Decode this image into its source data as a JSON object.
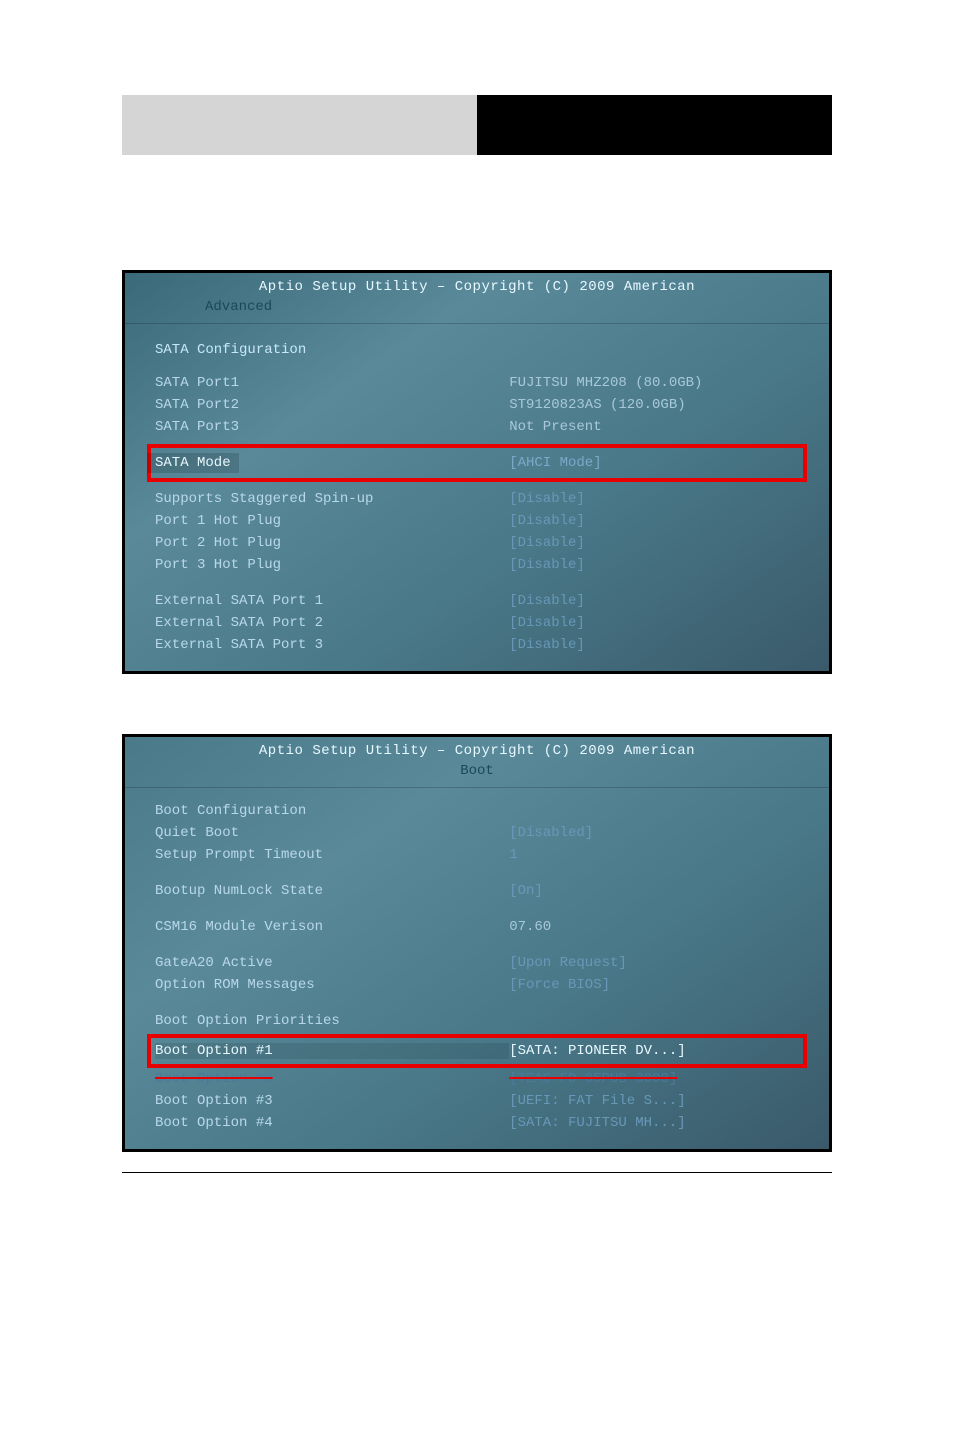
{
  "screenshot1": {
    "title": "Aptio Setup Utility – Copyright (C) 2009 American",
    "tab": "Advanced",
    "section_title": "SATA Configuration",
    "ports": [
      {
        "label": "SATA Port1",
        "value": "FUJITSU MHZ208 (80.0GB)"
      },
      {
        "label": "SATA Port2",
        "value": "ST9120823AS   (120.0GB)"
      },
      {
        "label": "SATA Port3",
        "value": "Not Present"
      }
    ],
    "highlighted": {
      "label": "SATA Mode",
      "value": "[AHCI Mode]"
    },
    "settings": [
      {
        "label": "Supports Staggered Spin-up",
        "value": "[Disable]"
      },
      {
        "label": "Port 1 Hot Plug",
        "value": "[Disable]"
      },
      {
        "label": "Port 2 Hot Plug",
        "value": "[Disable]"
      },
      {
        "label": "Port 3 Hot Plug",
        "value": "[Disable]"
      }
    ],
    "external": [
      {
        "label": "External SATA Port 1",
        "value": "[Disable]"
      },
      {
        "label": "External SATA Port 2",
        "value": "[Disable]"
      },
      {
        "label": "External SATA Port 3",
        "value": "[Disable]"
      }
    ]
  },
  "screenshot2": {
    "title": "Aptio Setup Utility – Copyright (C) 2009 American",
    "tab": "Boot",
    "section_title": "Boot Configuration",
    "rows1": [
      {
        "label": "Quiet Boot",
        "value": "[Disabled]"
      },
      {
        "label": "Setup Prompt Timeout",
        "value": "1"
      }
    ],
    "rows2": [
      {
        "label": "Bootup NumLock State",
        "value": "[On]"
      }
    ],
    "rows3": [
      {
        "label": "CSM16 Module Verison",
        "value": "07.60"
      }
    ],
    "rows4": [
      {
        "label": "GateA20 Active",
        "value": "[Upon Request]"
      },
      {
        "label": "Option ROM Messages",
        "value": "[Force BIOS]"
      }
    ],
    "priorities_title": "Boot Option Priorities",
    "boot1": {
      "label": "Boot Option #1",
      "value": "[SATA: PIONEER DV...]"
    },
    "boot2": {
      "label": "Boot Option #2",
      "value": "[TEAC FD-05PUB 3000]"
    },
    "boot3": {
      "label": "Boot Option #3",
      "value": "[UEFI: FAT File S...]"
    },
    "boot4": {
      "label": "Boot Option #4",
      "value": "[SATA: FUJITSU MH...]"
    }
  }
}
